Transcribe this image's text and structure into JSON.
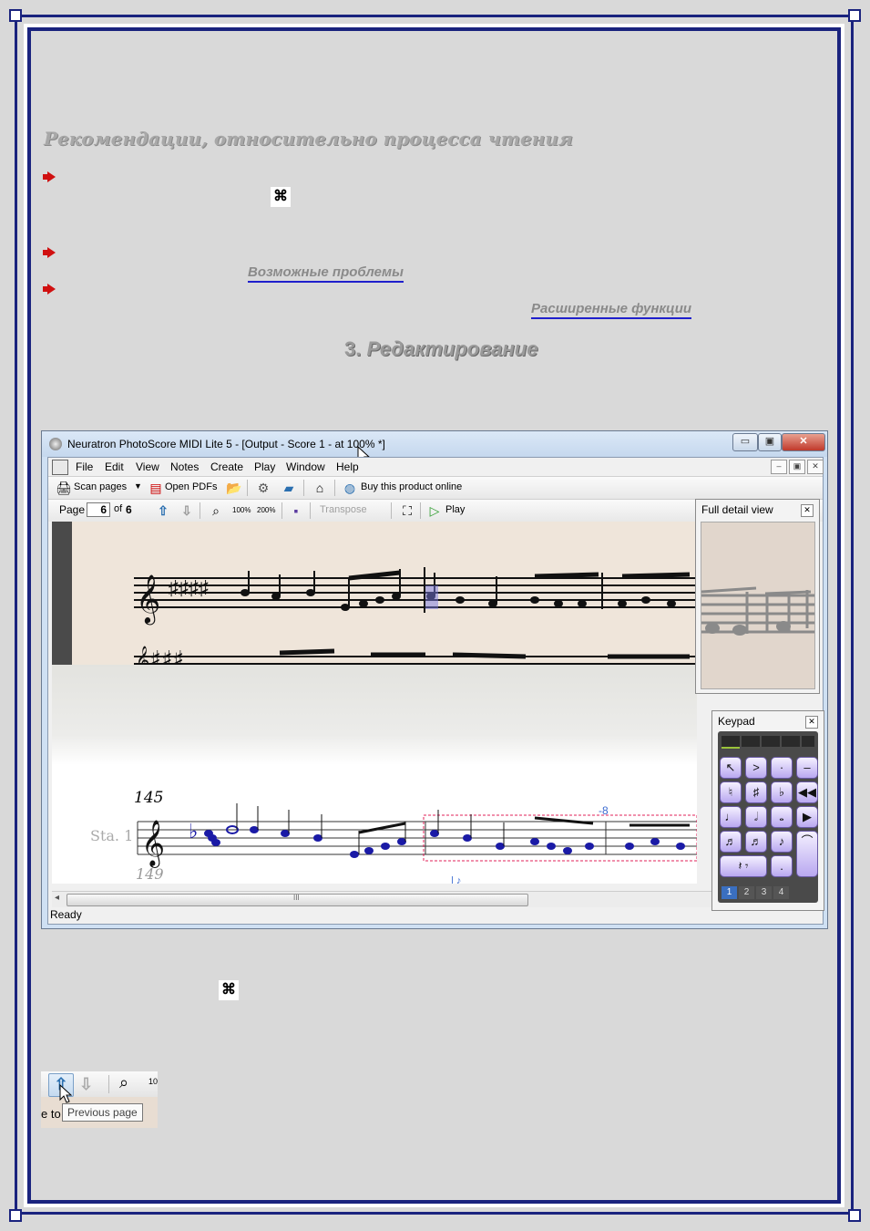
{
  "document": {
    "heading": "Рекомендации, относительно процесса чтения",
    "link_problems": "Возможные проблемы",
    "link_advanced": "Расширенные функции",
    "section_number": "3.",
    "section_title": "Редактирование",
    "cmd_symbol": "⌘"
  },
  "app": {
    "title": "Neuratron PhotoScore MIDI Lite 5 - [Output - Score 1 - at 100% *]",
    "window_buttons": {
      "minimize": "▭",
      "maximize": "▣",
      "close": "✕"
    },
    "menu": [
      "File",
      "Edit",
      "View",
      "Notes",
      "Create",
      "Play",
      "Window",
      "Help"
    ],
    "toolbar1": {
      "scan_pages": "Scan pages",
      "open_pdfs": "Open PDFs",
      "buy": "Buy this product online"
    },
    "toolbar2": {
      "page_label": "Page",
      "page_value": "6",
      "of_label": "of",
      "page_total": "6",
      "zoom100": "100%",
      "zoom200": "200%",
      "transpose": "Transpose",
      "play": "Play"
    },
    "score": {
      "measure_number_1": "145",
      "staff_label": "Sta. 1",
      "measure_number_2": "149"
    },
    "full_detail_title": "Full detail view",
    "keypad_title": "Keypad",
    "keypad_tabs": [
      "1",
      "2",
      "3",
      "4"
    ],
    "scroll_grip": "III",
    "status": "Ready"
  },
  "snippet": {
    "label_fragment": "e to",
    "tooltip": "Previous page",
    "zoom_fragment": "10"
  },
  "colors": {
    "frame": "#1a237e",
    "link_underline": "#1f1fcc",
    "bullet": "#d01010",
    "notes": "#1a1aa6"
  }
}
